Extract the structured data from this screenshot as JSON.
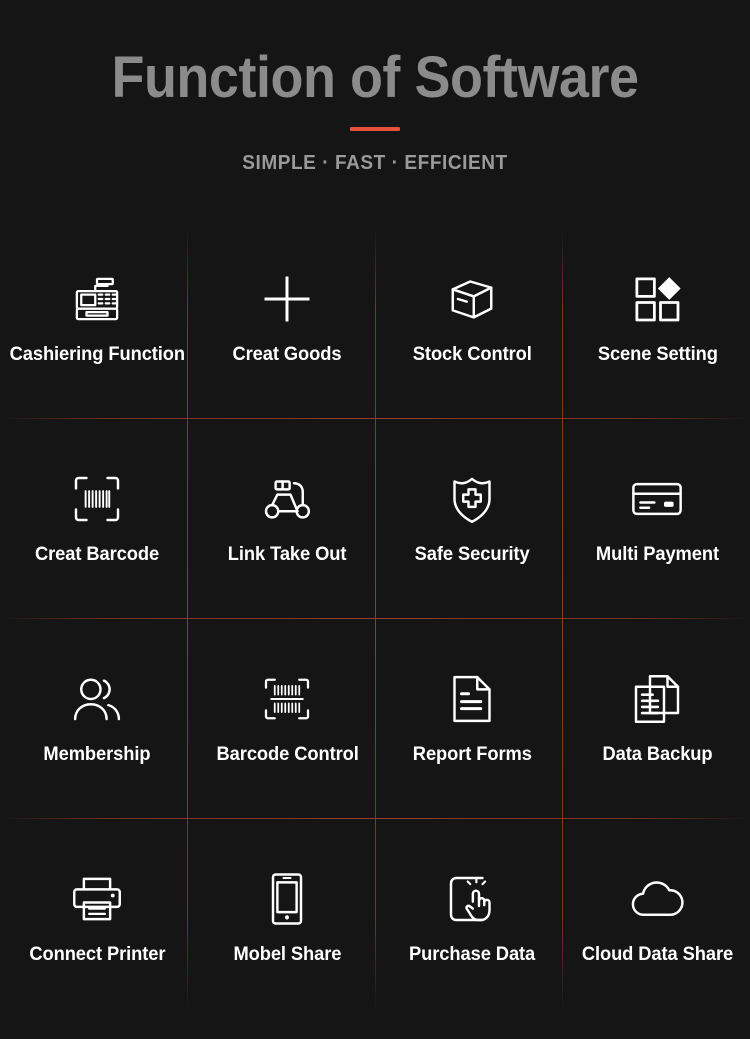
{
  "header": {
    "title": "Function of Software",
    "subtitle": "SIMPLE · FAST · EFFICIENT",
    "accent_color": "#e8503c",
    "title_color": "#8b8b8b",
    "subtitle_color": "#9a9a9a"
  },
  "theme": {
    "background": "#151515",
    "label_color": "#ffffff",
    "icon_color": "#ffffff",
    "divider_color": "#963a28"
  },
  "grid": {
    "columns": 4,
    "rows": 4,
    "items": [
      {
        "label": "Cashiering Function",
        "icon": "cash-register-icon"
      },
      {
        "label": "Creat Goods",
        "icon": "plus-icon"
      },
      {
        "label": "Stock Control",
        "icon": "box-icon"
      },
      {
        "label": "Scene Setting",
        "icon": "grid-diamond-icon"
      },
      {
        "label": "Creat Barcode",
        "icon": "barcode-scan-icon"
      },
      {
        "label": "Link Take Out",
        "icon": "scooter-icon"
      },
      {
        "label": "Safe Security",
        "icon": "shield-cross-icon"
      },
      {
        "label": "Multi Payment",
        "icon": "credit-card-icon"
      },
      {
        "label": "Membership",
        "icon": "users-icon"
      },
      {
        "label": "Barcode Control",
        "icon": "barcode-frame-icon"
      },
      {
        "label": "Report Forms",
        "icon": "document-icon"
      },
      {
        "label": "Data Backup",
        "icon": "documents-stack-icon"
      },
      {
        "label": "Connect Printer",
        "icon": "printer-icon"
      },
      {
        "label": "Mobel Share",
        "icon": "mobile-phone-icon"
      },
      {
        "label": "Purchase Data",
        "icon": "tap-hand-icon"
      },
      {
        "label": "Cloud Data Share",
        "icon": "cloud-icon"
      }
    ]
  }
}
